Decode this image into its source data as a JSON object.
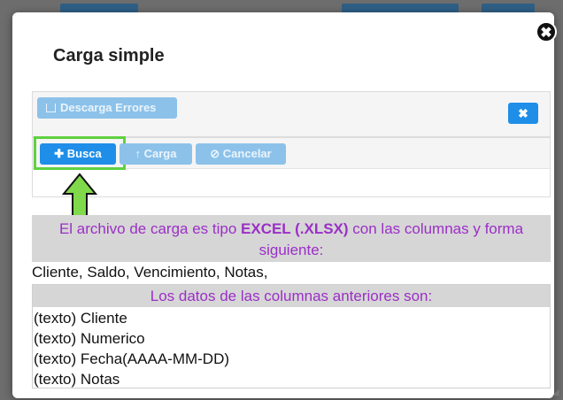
{
  "modal": {
    "title": "Carga simple",
    "close_glyph": "✖",
    "download_errors_label": "Descarga Errores",
    "dismiss_glyph": "✖"
  },
  "toolbar": {
    "busca_label": "Busca",
    "carga_label": "Carga",
    "cancelar_label": "Cancelar"
  },
  "info": {
    "line1_prefix": "El archivo de carga es tipo ",
    "file_type": "EXCEL (.XLSX)",
    "line1_suffix": " con las columnas y forma siguiente:",
    "columns_line": "Cliente, Saldo, Vencimiento, Notas,",
    "types_header": "Los datos de las columnas anteriores son:",
    "type_rows": [
      "(texto) Cliente",
      "(texto) Numerico",
      "(texto) Fecha(AAAA-MM-DD)",
      "(texto) Notas"
    ]
  },
  "colors": {
    "primary_button": "#1f8ee8",
    "disabled_button": "#8cc2ea",
    "highlight_border": "#5fd140",
    "info_text": "#9b2fc7"
  },
  "icons": [
    "close-icon",
    "download-icon",
    "plus-icon",
    "upload-icon",
    "cancel-icon",
    "arrow-up-icon"
  ]
}
